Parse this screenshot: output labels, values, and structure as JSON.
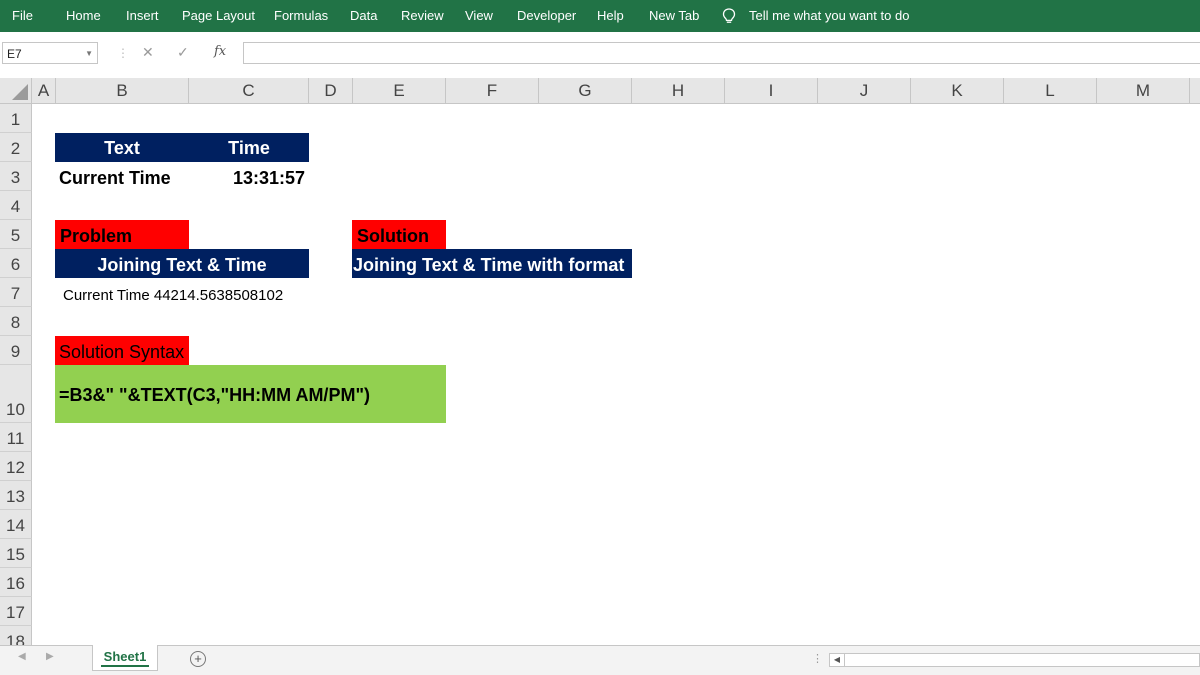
{
  "ribbon": {
    "tabs": [
      "File",
      "Home",
      "Insert",
      "Page Layout",
      "Formulas",
      "Data",
      "Review",
      "View",
      "Developer",
      "Help",
      "New Tab"
    ],
    "tell_me": "Tell me what you want to do",
    "background": "#217346"
  },
  "formula_bar": {
    "name_box": "E7",
    "fx_label": "fx",
    "formula": ""
  },
  "columns": [
    "A",
    "B",
    "C",
    "D",
    "E",
    "F",
    "G",
    "H",
    "I",
    "J",
    "K",
    "L",
    "M"
  ],
  "rows": [
    "1",
    "2",
    "3",
    "4",
    "5",
    "6",
    "7",
    "8",
    "9",
    "10",
    "11",
    "12",
    "13",
    "14",
    "15",
    "16",
    "17",
    "18"
  ],
  "cells": {
    "b2": "Text",
    "c2": "Time",
    "b3": "Current Time",
    "c3": "13:31:57",
    "b5": "Problem",
    "b6": "Joining Text & Time",
    "b7": "Current Time  44214.5638508102",
    "e5": "Solution",
    "e6": "Joining Text & Time with format",
    "b9": "Solution Syntax",
    "b10": "=B3&\"  \"&TEXT(C3,\"HH:MM  AM/PM\")"
  },
  "colors": {
    "header_fill": "#002060",
    "label_fill": "#ff0000",
    "syntax_fill": "#92d050"
  },
  "sheet_tabs": [
    "Sheet1"
  ]
}
